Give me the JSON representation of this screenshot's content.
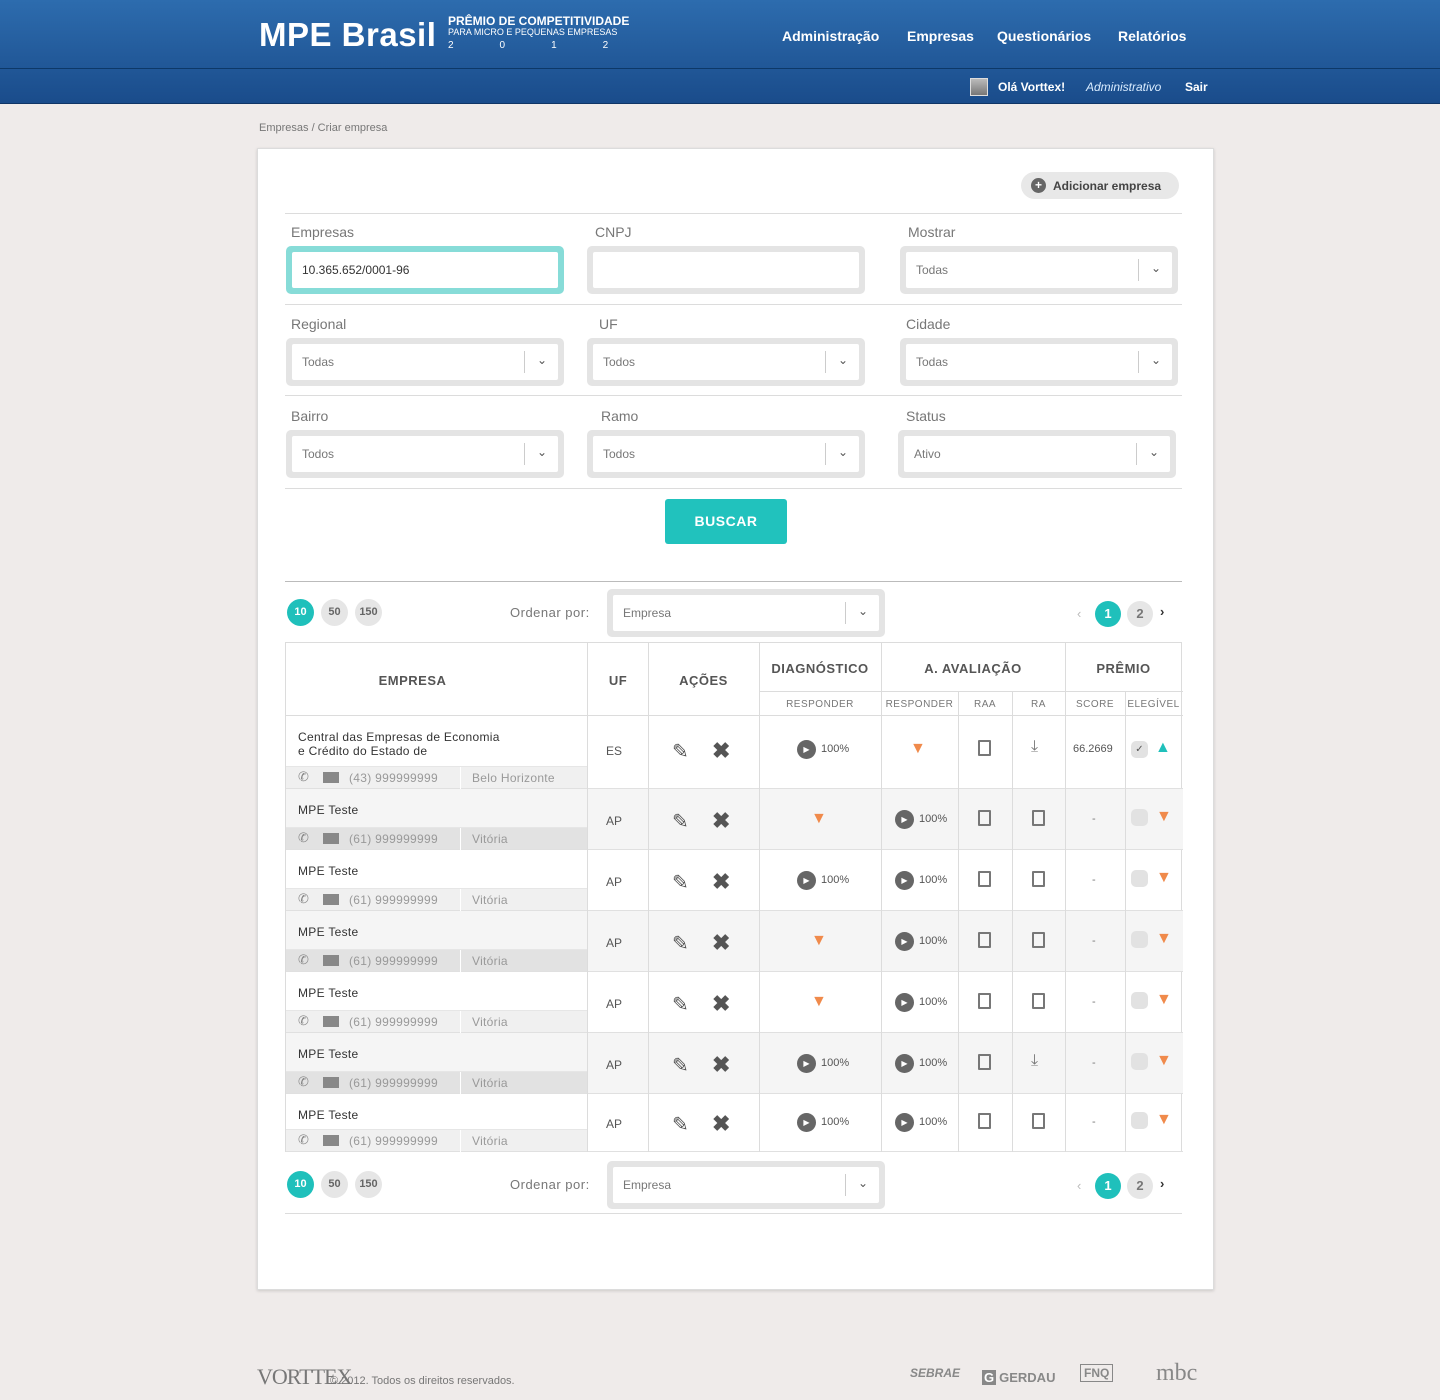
{
  "app": {
    "logo": "MPE Brasil",
    "tagline1": "PRÊMIO DE COMPETITIVIDADE",
    "tagline2": "PARA MICRO E PEQUENAS EMPRESAS",
    "tagline3": "2012"
  },
  "nav": [
    "Administração",
    "Empresas",
    "Questionários",
    "Relatórios"
  ],
  "user": {
    "hello": "Olá  Vorttex!",
    "role": "Administrativo",
    "logout": "Sair"
  },
  "breadcrumb": "Empresas  / Criar empresa",
  "add_button": "Adicionar empresa",
  "filters": {
    "empresas": {
      "label": "Empresas",
      "value": "10.365.652/0001-96"
    },
    "cnpj": {
      "label": "CNPJ",
      "value": ""
    },
    "mostrar": {
      "label": "Mostrar",
      "value": "Todas"
    },
    "regional": {
      "label": "Regional",
      "value": "Todas"
    },
    "uf": {
      "label": "UF",
      "value": "Todos"
    },
    "cidade": {
      "label": "Cidade",
      "value": "Todas"
    },
    "bairro": {
      "label": "Bairro",
      "value": "Todos"
    },
    "ramo": {
      "label": "Ramo",
      "value": "Todos"
    },
    "status": {
      "label": "Status",
      "value": "Ativo"
    }
  },
  "search_button": "BUSCAR",
  "per_page": [
    "10",
    "50",
    "150"
  ],
  "order_label": "Ordenar por:",
  "order_value": "Empresa",
  "pages": [
    "1",
    "2"
  ],
  "icons": {
    "prev": "chevron-left-icon",
    "next": "chevron-right-icon",
    "dropdown": "chevron-down-icon"
  },
  "colors": {
    "accent": "#1fc0bb",
    "header": "#1f5494",
    "thumb_down": "#f08a4b"
  },
  "table": {
    "headers": {
      "empresa": "EMPRESA",
      "uf": "UF",
      "acoes": "AÇÕES",
      "diagnostico": "DIAGNÓSTICO",
      "avaliacao": "A. AVALIAÇÃO",
      "premio": "PRÊMIO",
      "responder1": "RESPONDER",
      "responder2": "RESPONDER",
      "raa": "RAA",
      "ra": "RA",
      "score": "SCORE",
      "elegivel": "ELEGÍVEL"
    },
    "rows": [
      {
        "name1": "Central das Empresas de Economia",
        "name2": "e Crédito do Estado de",
        "phone": "(43) 999999999",
        "city": "Belo Horizonte",
        "uf": "ES",
        "diag": "100%",
        "aval": "thumb-down",
        "raa": "doc",
        "ra": "download",
        "score": "66.2669",
        "elig": "checked-thumb-up"
      },
      {
        "name1": "MPE Teste",
        "name2": "",
        "phone": "(61) 999999999",
        "city": "Vitória",
        "uf": "AP",
        "diag": "thumb-down",
        "aval": "100%",
        "raa": "doc",
        "ra": "doc",
        "score": "-",
        "elig": "thumb-down"
      },
      {
        "name1": "MPE Teste",
        "name2": "",
        "phone": "(61) 999999999",
        "city": "Vitória",
        "uf": "AP",
        "diag": "100%",
        "aval": "100%",
        "raa": "doc",
        "ra": "doc",
        "score": "-",
        "elig": "thumb-down"
      },
      {
        "name1": "MPE Teste",
        "name2": "",
        "phone": "(61) 999999999",
        "city": "Vitória",
        "uf": "AP",
        "diag": "thumb-down",
        "aval": "100%",
        "raa": "doc",
        "ra": "doc",
        "score": "-",
        "elig": "thumb-down"
      },
      {
        "name1": "MPE Teste",
        "name2": "",
        "phone": "(61) 999999999",
        "city": "Vitória",
        "uf": "AP",
        "diag": "thumb-down",
        "aval": "100%",
        "raa": "doc",
        "ra": "doc",
        "score": "-",
        "elig": "thumb-down"
      },
      {
        "name1": "MPE Teste",
        "name2": "",
        "phone": "(61) 999999999",
        "city": "Vitória",
        "uf": "AP",
        "diag": "100%",
        "aval": "100%",
        "raa": "doc",
        "ra": "download",
        "score": "-",
        "elig": "thumb-down"
      },
      {
        "name1": "MPE Teste",
        "name2": "",
        "phone": "(61) 999999999",
        "city": "Vitória",
        "uf": "AP",
        "diag": "100%",
        "aval": "100%",
        "raa": "doc",
        "ra": "doc",
        "score": "-",
        "elig": "thumb-down"
      }
    ]
  },
  "footer": {
    "brand": "VORTTEX",
    "copyright": "© 2012. Todos os direitos reservados.",
    "partners": [
      "SEBRAE",
      "GERDAU",
      "FNQ",
      "mbc"
    ]
  }
}
